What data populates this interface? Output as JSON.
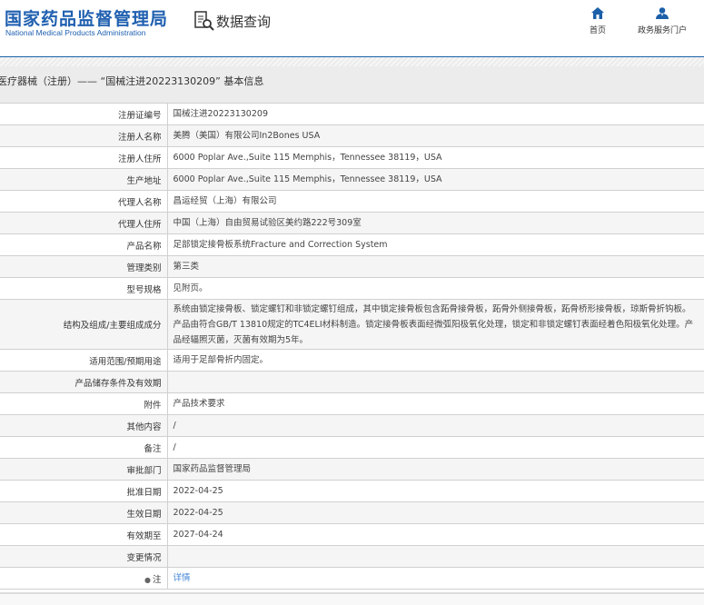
{
  "header": {
    "logo_cn": "国家药品监督管理局",
    "logo_en": "National Medical Products Administration",
    "query_label": "数据查询",
    "nav": [
      {
        "label": "首页",
        "icon": "home-icon"
      },
      {
        "label": "政务服务门户",
        "icon": "user-icon"
      }
    ]
  },
  "breadcrumb": "医疗器械（注册）—— “国械注进20223130209” 基本信息",
  "rows": [
    {
      "k": "注册证编号",
      "v": "国械注进20223130209"
    },
    {
      "k": "注册人名称",
      "v": "美腾（美国）有限公司In2Bones USA"
    },
    {
      "k": "注册人住所",
      "v": "6000 Poplar Ave.,Suite 115 Memphis，Tennessee 38119，USA"
    },
    {
      "k": "生产地址",
      "v": "6000 Poplar Ave.,Suite 115 Memphis，Tennessee 38119，USA"
    },
    {
      "k": "代理人名称",
      "v": "昌运经贸（上海）有限公司"
    },
    {
      "k": "代理人住所",
      "v": "中国（上海）自由贸易试验区美约路222号309室"
    },
    {
      "k": "产品名称",
      "v": "足部锁定接骨板系统Fracture and Correction System"
    },
    {
      "k": "管理类别",
      "v": "第三类"
    },
    {
      "k": "型号规格",
      "v": "见附页。"
    },
    {
      "k": "结构及组成/主要组成成分",
      "v": "系统由锁定接骨板、锁定螺钉和非锁定螺钉组成，其中锁定接骨板包含跖骨接骨板，跖骨外侧接骨板，跖骨桥形接骨板，琼斯骨折钩板。产品由符合GB/T 13810规定的TC4ELI材料制造。锁定接骨板表面经微弧阳极氧化处理，锁定和非锁定螺钉表面经着色阳极氧化处理。产品经辐照灭菌，灭菌有效期为5年。"
    },
    {
      "k": "适用范围/预期用途",
      "v": "适用于足部骨折内固定。"
    },
    {
      "k": "产品储存条件及有效期",
      "v": ""
    },
    {
      "k": "附件",
      "v": "产品技术要求"
    },
    {
      "k": "其他内容",
      "v": "/"
    },
    {
      "k": "备注",
      "v": "/"
    },
    {
      "k": "审批部门",
      "v": "国家药品监督管理局"
    },
    {
      "k": "批准日期",
      "v": "2022-04-25"
    },
    {
      "k": "生效日期",
      "v": "2022-04-25"
    },
    {
      "k": "有效期至",
      "v": "2027-04-24"
    },
    {
      "k": "变更情况",
      "v": ""
    },
    {
      "k": "注",
      "v": "详情"
    }
  ]
}
